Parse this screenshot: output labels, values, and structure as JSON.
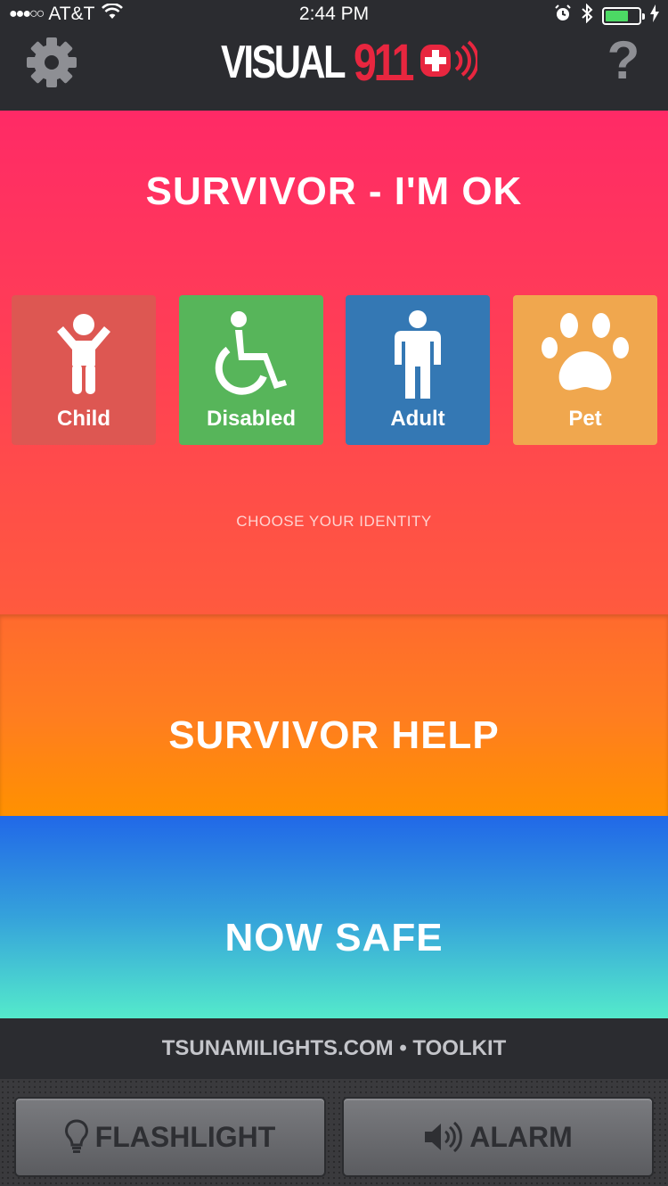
{
  "status_bar": {
    "signal": "●●●○○",
    "carrier": "AT&T",
    "time": "2:44 PM"
  },
  "header": {
    "logo_text": "VISUAL",
    "logo_number": "911",
    "help_label": "?"
  },
  "survivor_ok": {
    "title": "SURVIVOR - I'M OK",
    "identities": [
      {
        "label": "Child",
        "icon": "child-icon",
        "color": "#dd5752"
      },
      {
        "label": "Disabled",
        "icon": "wheelchair-icon",
        "color": "#57b55a"
      },
      {
        "label": "Adult",
        "icon": "adult-icon",
        "color": "#3478b4"
      },
      {
        "label": "Pet",
        "icon": "paw-icon",
        "color": "#f0a74e"
      }
    ],
    "instruction": "CHOOSE YOUR IDENTITY"
  },
  "survivor_help": {
    "title": "SURVIVOR HELP"
  },
  "now_safe": {
    "title": "NOW SAFE"
  },
  "footer": {
    "link_text": "TSUNAMILIGHTS.COM • TOOLKIT"
  },
  "toolbar": {
    "flashlight_label": "FLASHLIGHT",
    "alarm_label": "ALARM"
  },
  "colors": {
    "ok_top": "#ff2a66",
    "help_bottom": "#ff9100",
    "safe_top": "#2168e8",
    "safe_bottom": "#54eacb",
    "header_bg": "#2b2c30",
    "brand_red": "#e8263f"
  }
}
